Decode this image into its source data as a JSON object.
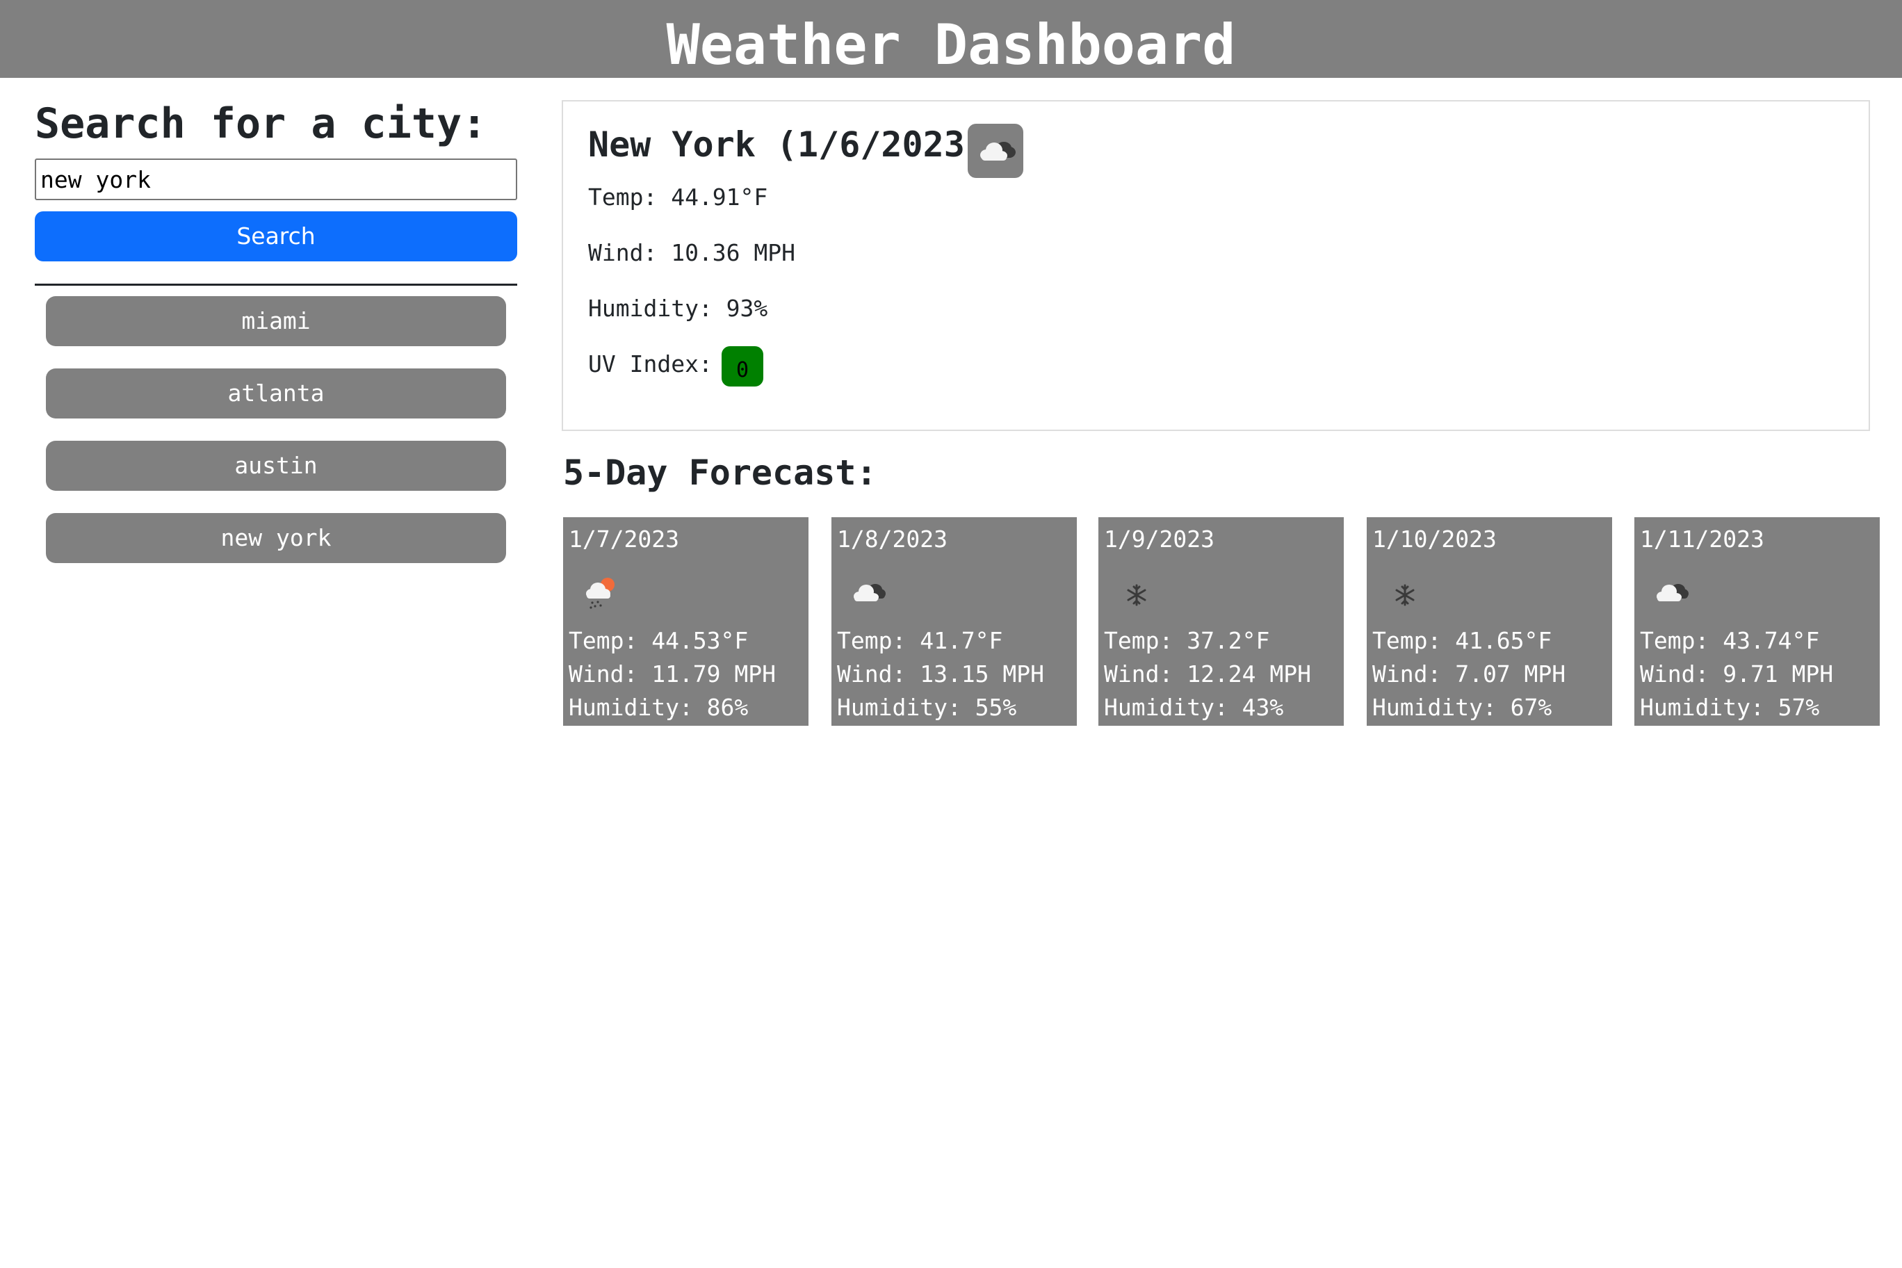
{
  "header": {
    "title": "Weather Dashboard"
  },
  "sidebar": {
    "search_title": "Search for a city:",
    "search_value": "new york",
    "search_button": "Search",
    "history": [
      "miami",
      "atlanta",
      "austin",
      "new york"
    ]
  },
  "current": {
    "title": "New York (1/6/2023)",
    "icon": "broken-clouds-icon",
    "temp": "Temp: 44.91°F",
    "wind": "Wind: 10.36 MPH",
    "humidity": "Humidity: 93%",
    "uv_label": "UV Index:",
    "uv_value": "0",
    "uv_color": "#008000"
  },
  "forecast": {
    "title": "5-Day Forecast:",
    "days": [
      {
        "date": "1/7/2023",
        "icon": "snow-rain-sun-icon",
        "temp": "Temp: 44.53°F",
        "wind": "Wind: 11.79 MPH",
        "humidity": "Humidity: 86%"
      },
      {
        "date": "1/8/2023",
        "icon": "broken-clouds-icon",
        "temp": "Temp: 41.7°F",
        "wind": "Wind: 13.15 MPH",
        "humidity": "Humidity: 55%"
      },
      {
        "date": "1/9/2023",
        "icon": "snowflake-icon",
        "temp": "Temp: 37.2°F",
        "wind": "Wind: 12.24 MPH",
        "humidity": "Humidity: 43%"
      },
      {
        "date": "1/10/2023",
        "icon": "snowflake-icon",
        "temp": "Temp: 41.65°F",
        "wind": "Wind: 7.07 MPH",
        "humidity": "Humidity: 67%"
      },
      {
        "date": "1/11/2023",
        "icon": "broken-clouds-icon",
        "temp": "Temp: 43.74°F",
        "wind": "Wind: 9.71 MPH",
        "humidity": "Humidity: 57%"
      }
    ]
  },
  "colors": {
    "header_bg": "#808080",
    "search_button_bg": "#0d6efd",
    "history_button_bg": "#808080",
    "forecast_card_bg": "#808080",
    "uv_low": "#008000"
  }
}
